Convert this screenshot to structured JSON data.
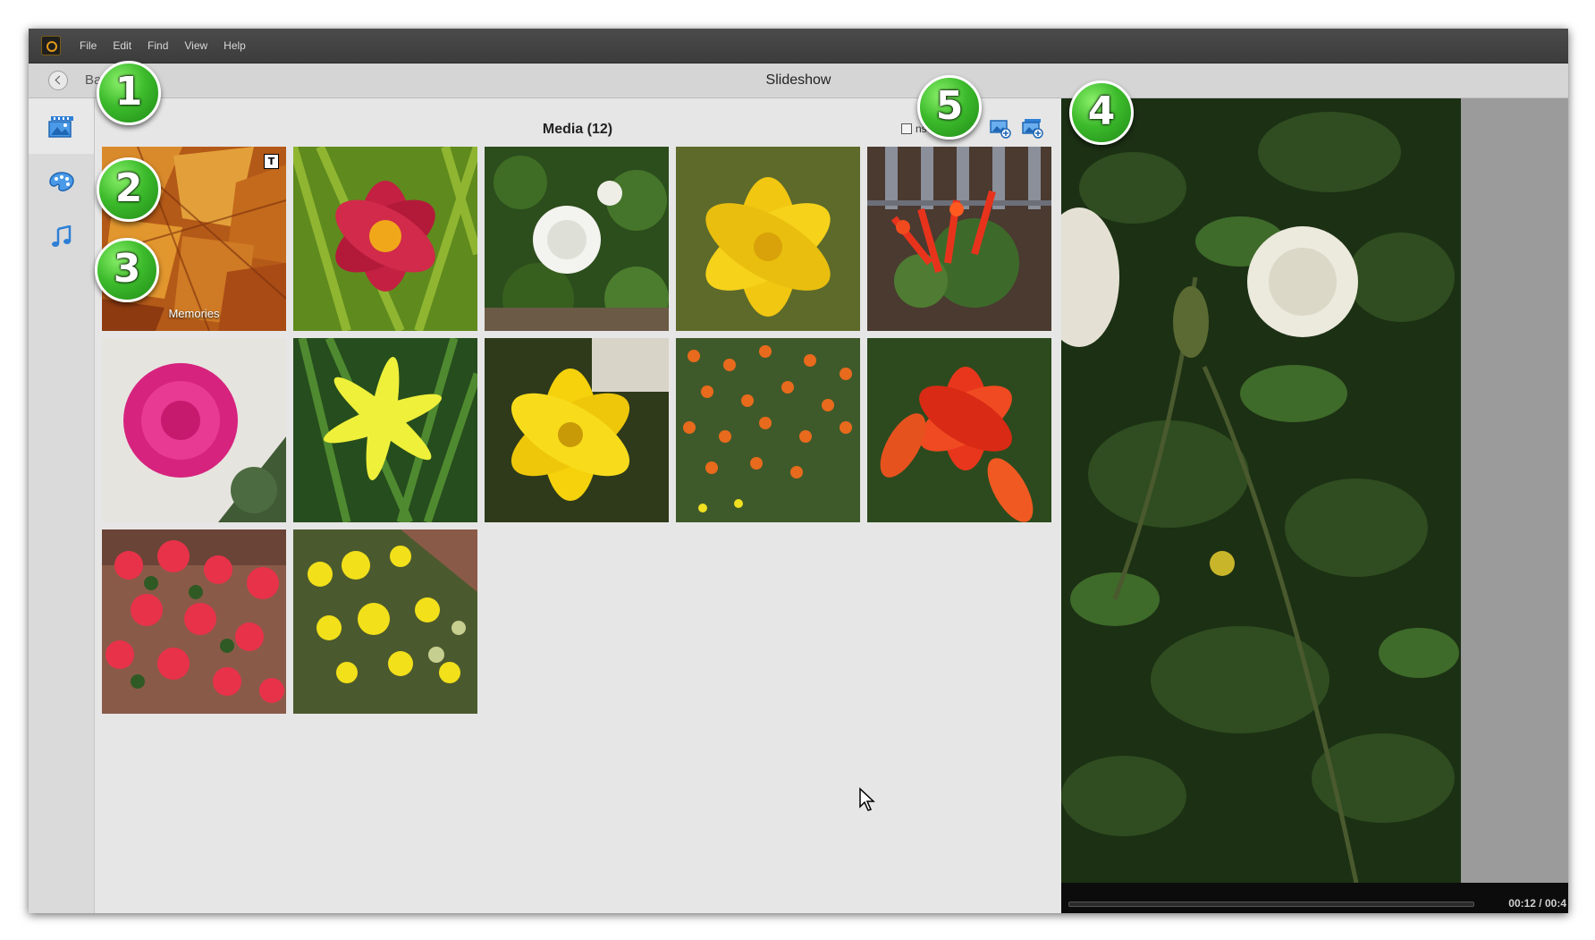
{
  "menubar": {
    "items": [
      "File",
      "Edit",
      "Find",
      "View",
      "Help"
    ]
  },
  "toolbar": {
    "back_label": "Ba",
    "title": "Slideshow"
  },
  "sidebar": {
    "items": [
      {
        "name": "media",
        "icon": "media-icon"
      },
      {
        "name": "themes",
        "icon": "palette-icon"
      },
      {
        "name": "audio",
        "icon": "music-note-icon"
      }
    ]
  },
  "media": {
    "title": "Media (12)",
    "options_label": "ns",
    "thumbnails": [
      {
        "caption": "Memories",
        "badge": "T"
      },
      {
        "caption": ""
      },
      {
        "caption": ""
      },
      {
        "caption": ""
      },
      {
        "caption": ""
      },
      {
        "caption": ""
      },
      {
        "caption": ""
      },
      {
        "caption": ""
      },
      {
        "caption": ""
      },
      {
        "caption": ""
      },
      {
        "caption": ""
      },
      {
        "caption": ""
      }
    ]
  },
  "player": {
    "time": "00:12 / 00:4"
  },
  "callouts": [
    "1",
    "2",
    "3",
    "4",
    "5"
  ],
  "colors": {
    "accent_green": "#3dbb2c",
    "menubar": "#3f3f3f"
  }
}
